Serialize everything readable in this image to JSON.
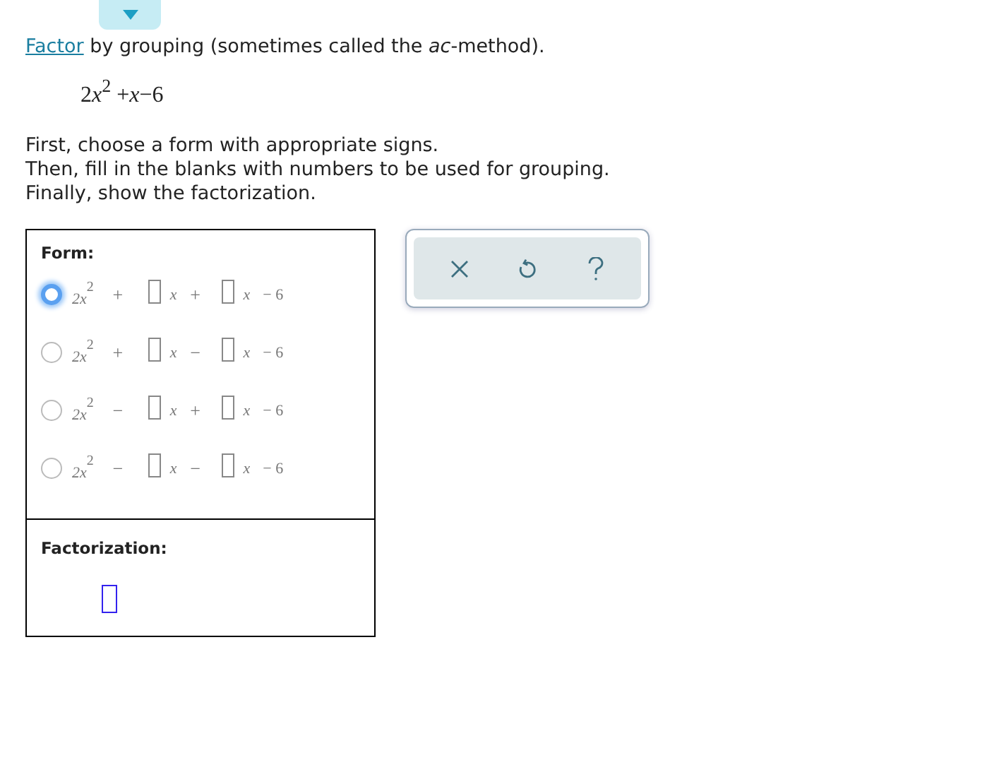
{
  "toggle": {
    "expanded": false
  },
  "intro": {
    "link": "Factor",
    "text": " by grouping (sometimes called the *ac*-method)."
  },
  "expression": {
    "coef": "2",
    "var": "x",
    "exp": "2",
    "op": "+",
    "var2": "x",
    "rest": "−6"
  },
  "instructions": [
    "First, choose a form with appropriate signs.",
    "Then, fill in the blanks with numbers to be used for grouping.",
    "Finally, show the factorization."
  ],
  "form": {
    "label": "Form:",
    "options": [
      {
        "lead": "2x",
        "exp": "2",
        "sign1": "+",
        "var1": "x",
        "sign2": "+",
        "var2": "x",
        "tail": "− 6",
        "selected": false,
        "focused": true
      },
      {
        "lead": "2x",
        "exp": "2",
        "sign1": "+",
        "var1": "x",
        "sign2": "−",
        "var2": "x",
        "tail": "− 6",
        "selected": false,
        "focused": false
      },
      {
        "lead": "2x",
        "exp": "2",
        "sign1": "−",
        "var1": "x",
        "sign2": "+",
        "var2": "x",
        "tail": "− 6",
        "selected": false,
        "focused": false
      },
      {
        "lead": "2x",
        "exp": "2",
        "sign1": "−",
        "var1": "x",
        "sign2": "−",
        "var2": "x",
        "tail": "− 6",
        "selected": false,
        "focused": false
      }
    ]
  },
  "factorization": {
    "label": "Factorization:",
    "focused": true
  }
}
